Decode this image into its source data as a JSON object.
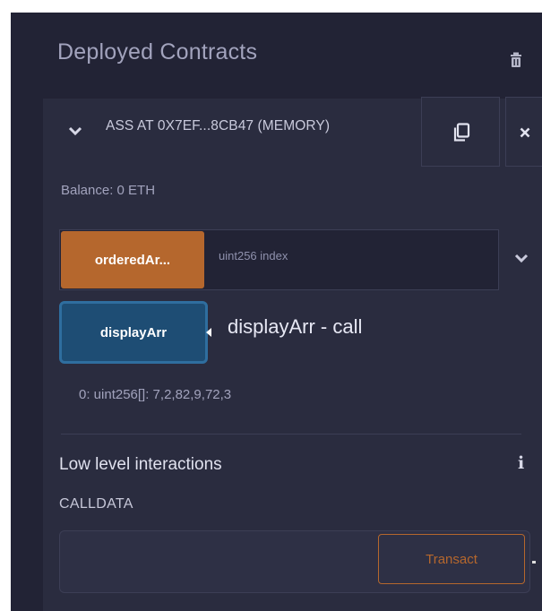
{
  "section": {
    "title": "Deployed Contracts",
    "trash_icon": "trash-icon"
  },
  "instance": {
    "chevron_icon": "chevron-down-icon",
    "title": "ASS AT 0X7EF...8CB47 (MEMORY)",
    "copy_icon": "copy-icon",
    "close_icon": "close-icon",
    "balance": "Balance: 0 ETH"
  },
  "functions": {
    "ordered": {
      "label": "orderedAr...",
      "input_placeholder": "uint256 index",
      "expand_icon": "chevron-down-icon"
    },
    "display": {
      "label": "displayArr",
      "tooltip": "displayArr - call",
      "result": "0: uint256[]: 7,2,82,9,72,3"
    }
  },
  "low_level": {
    "title": "Low level interactions",
    "info_icon": "info-icon",
    "calldata_label": "CALLDATA",
    "calldata_value": "",
    "transact_label": "Transact"
  },
  "colors": {
    "panel_bg": "#222335",
    "card_bg": "#2a2c3f",
    "orange": "#b5672d",
    "blue": "#1e4d74",
    "muted_text": "#a2a3bd"
  }
}
